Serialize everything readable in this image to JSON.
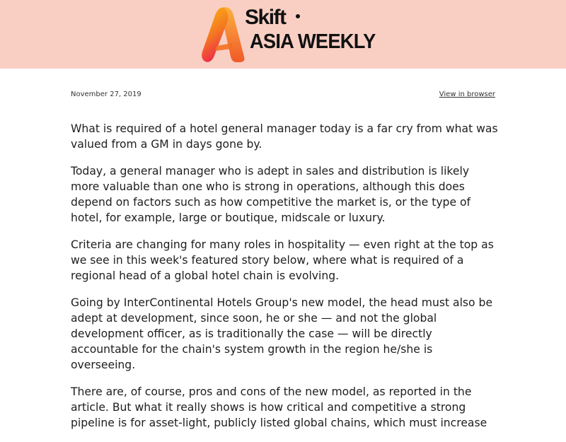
{
  "header": {
    "brand": "Skift",
    "subtitle": "ASIA WEEKLY",
    "colors": {
      "banner": "#f9cfc4",
      "logo_gradient_top": "#fdb813",
      "logo_gradient_bottom": "#ee2b4a"
    }
  },
  "meta": {
    "date": "November 27, 2019",
    "view_link": "View in browser"
  },
  "article": {
    "paragraphs": [
      "What is required of a hotel general manager today is a far cry from what was valued from a GM in days gone by.",
      "Today, a general manager who is adept in sales and distribution is likely more valuable than one who is strong in operations, although this does depend on factors such as how competitive the market is, or the type of hotel, for example, large or boutique, midscale or luxury.",
      "Criteria are changing for many roles in hospitality — even right at the top as we see in this week's featured story below, where what is required of a regional head of a global hotel chain is evolving.",
      "Going by InterContinental Hotels Group's new model, the head must also be adept at development, since soon, he or she — and not the global development officer, as is traditionally the case — will be directly accountable for the chain's system growth in the region he/she is overseeing.",
      "There are, of course, pros and cons of the new model, as reported in the article. But what it really shows is how critical and competitive a strong pipeline is for asset-light, publicly listed global chains, which must increase"
    ]
  }
}
